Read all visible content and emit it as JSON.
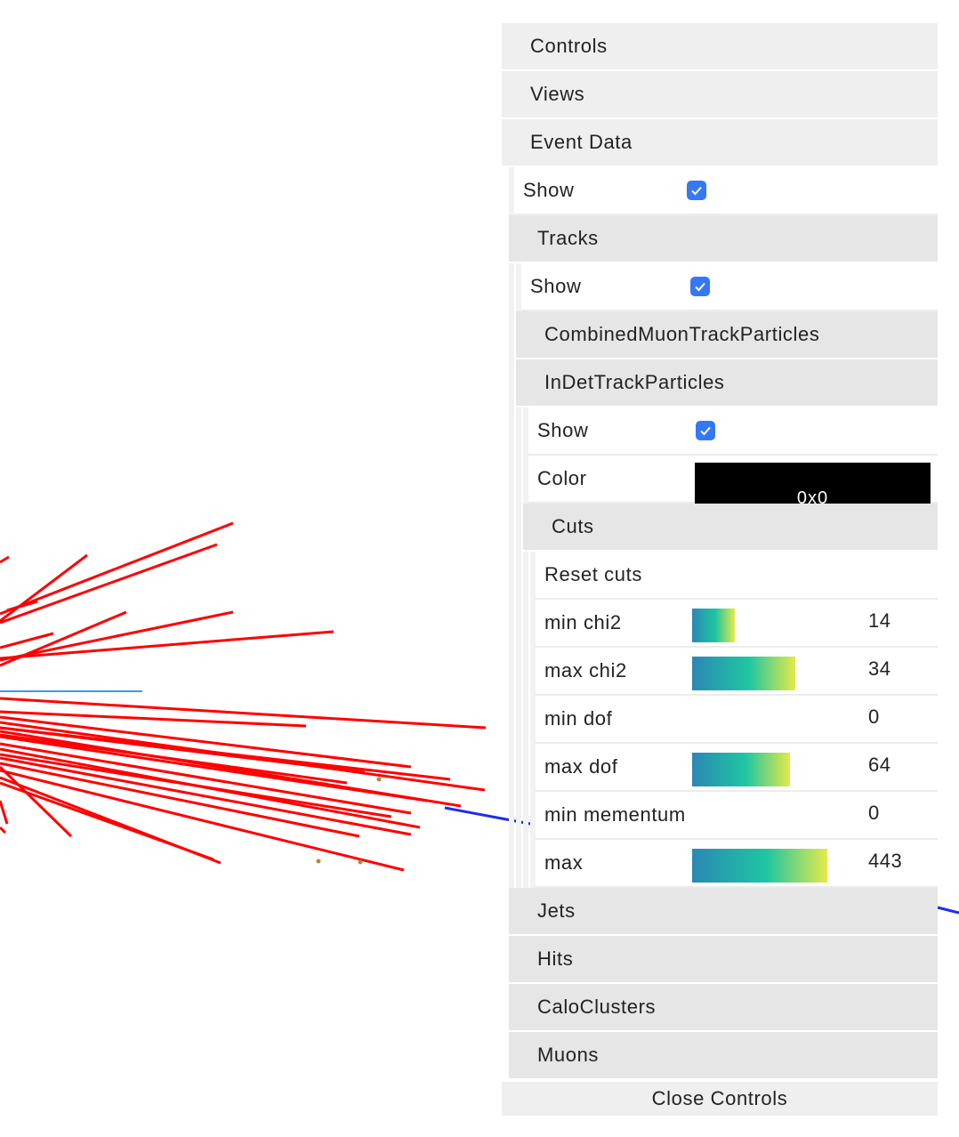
{
  "panel": {
    "folders": {
      "controls": "Controls",
      "views": "Views",
      "event_data": "Event Data",
      "tracks": "Tracks",
      "combined_muon": "CombinedMuonTrackParticles",
      "indet": "InDetTrackParticles",
      "cuts": "Cuts",
      "jets": "Jets",
      "hits": "Hits",
      "calo_clusters": "CaloClusters",
      "muons": "Muons"
    },
    "event_data_show": {
      "label": "Show",
      "checked": true
    },
    "tracks_show": {
      "label": "Show",
      "checked": true
    },
    "indet_show": {
      "label": "Show",
      "checked": true
    },
    "indet_color": {
      "label": "Color",
      "value": "0x0",
      "swatch": "#000000"
    },
    "cuts": {
      "reset": "Reset cuts",
      "sliders": [
        {
          "label": "min chi2",
          "value": "14",
          "fill_fraction": 0.24
        },
        {
          "label": "max chi2",
          "value": "34",
          "fill_fraction": 0.58
        },
        {
          "label": "min dof",
          "value": "0",
          "fill_fraction": 0
        },
        {
          "label": "max dof",
          "value": "64",
          "fill_fraction": 0.55
        },
        {
          "label": "min mementum",
          "value": "0",
          "fill_fraction": 0
        },
        {
          "label": "max",
          "value": "443",
          "fill_fraction": 0.76
        }
      ]
    },
    "close_label": "Close Controls"
  },
  "colors": {
    "track_red": "#ff0000",
    "muon_blue": "#1b2fe6",
    "light_blue": "#3a9ae8",
    "checkbox_blue": "#3478f6"
  }
}
